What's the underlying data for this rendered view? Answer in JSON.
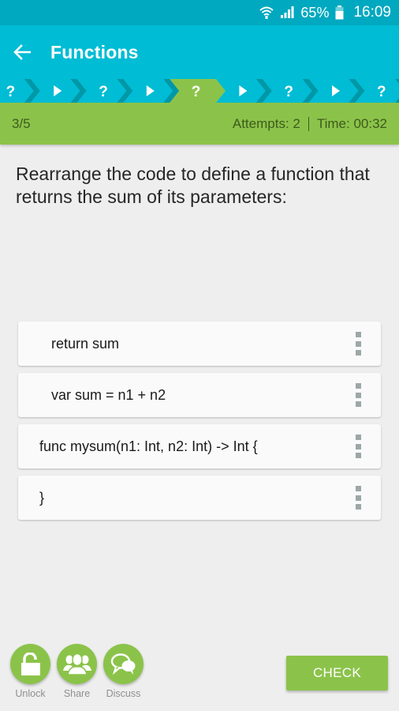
{
  "status_bar": {
    "wifi_icon": "wifi-icon",
    "signal_icon": "signal-icon",
    "battery_percent": "65%",
    "battery_icon": "battery-icon",
    "time": "16:09"
  },
  "app_bar": {
    "back_icon": "arrow-left-icon",
    "title": "Functions"
  },
  "progress_steps": [
    {
      "type": "quiz",
      "symbol": "?",
      "state": "upcoming"
    },
    {
      "type": "lesson",
      "symbol": "play",
      "state": "upcoming"
    },
    {
      "type": "quiz",
      "symbol": "?",
      "state": "upcoming"
    },
    {
      "type": "lesson",
      "symbol": "play",
      "state": "upcoming"
    },
    {
      "type": "quiz",
      "symbol": "?",
      "state": "current"
    },
    {
      "type": "lesson",
      "symbol": "play",
      "state": "upcoming"
    },
    {
      "type": "quiz",
      "symbol": "?",
      "state": "upcoming"
    },
    {
      "type": "lesson",
      "symbol": "play",
      "state": "upcoming"
    },
    {
      "type": "quiz",
      "symbol": "?",
      "state": "upcoming"
    }
  ],
  "info_bar": {
    "progress": "3/5",
    "attempts": "Attempts: 2",
    "time": "Time: 00:32"
  },
  "question": {
    "text": "Rearrange the code to define a function that returns the sum of its parameters:"
  },
  "code_lines": [
    {
      "text": "return sum",
      "indented": true
    },
    {
      "text": "var sum = n1 + n2",
      "indented": true
    },
    {
      "text": "func mysum(n1: Int, n2: Int) -> Int {",
      "indented": false
    },
    {
      "text": "}",
      "indented": false
    }
  ],
  "actions": [
    {
      "label": "Unlock",
      "icon": "unlock-icon"
    },
    {
      "label": "Share",
      "icon": "share-people-icon"
    },
    {
      "label": "Discuss",
      "icon": "chat-bubbles-icon"
    }
  ],
  "check_button": {
    "label": "CHECK"
  },
  "colors": {
    "primary": "#00bcd4",
    "primary_dark": "#00a9c0",
    "accent_green": "#8bc34a",
    "step_separator": "#0097a7"
  }
}
